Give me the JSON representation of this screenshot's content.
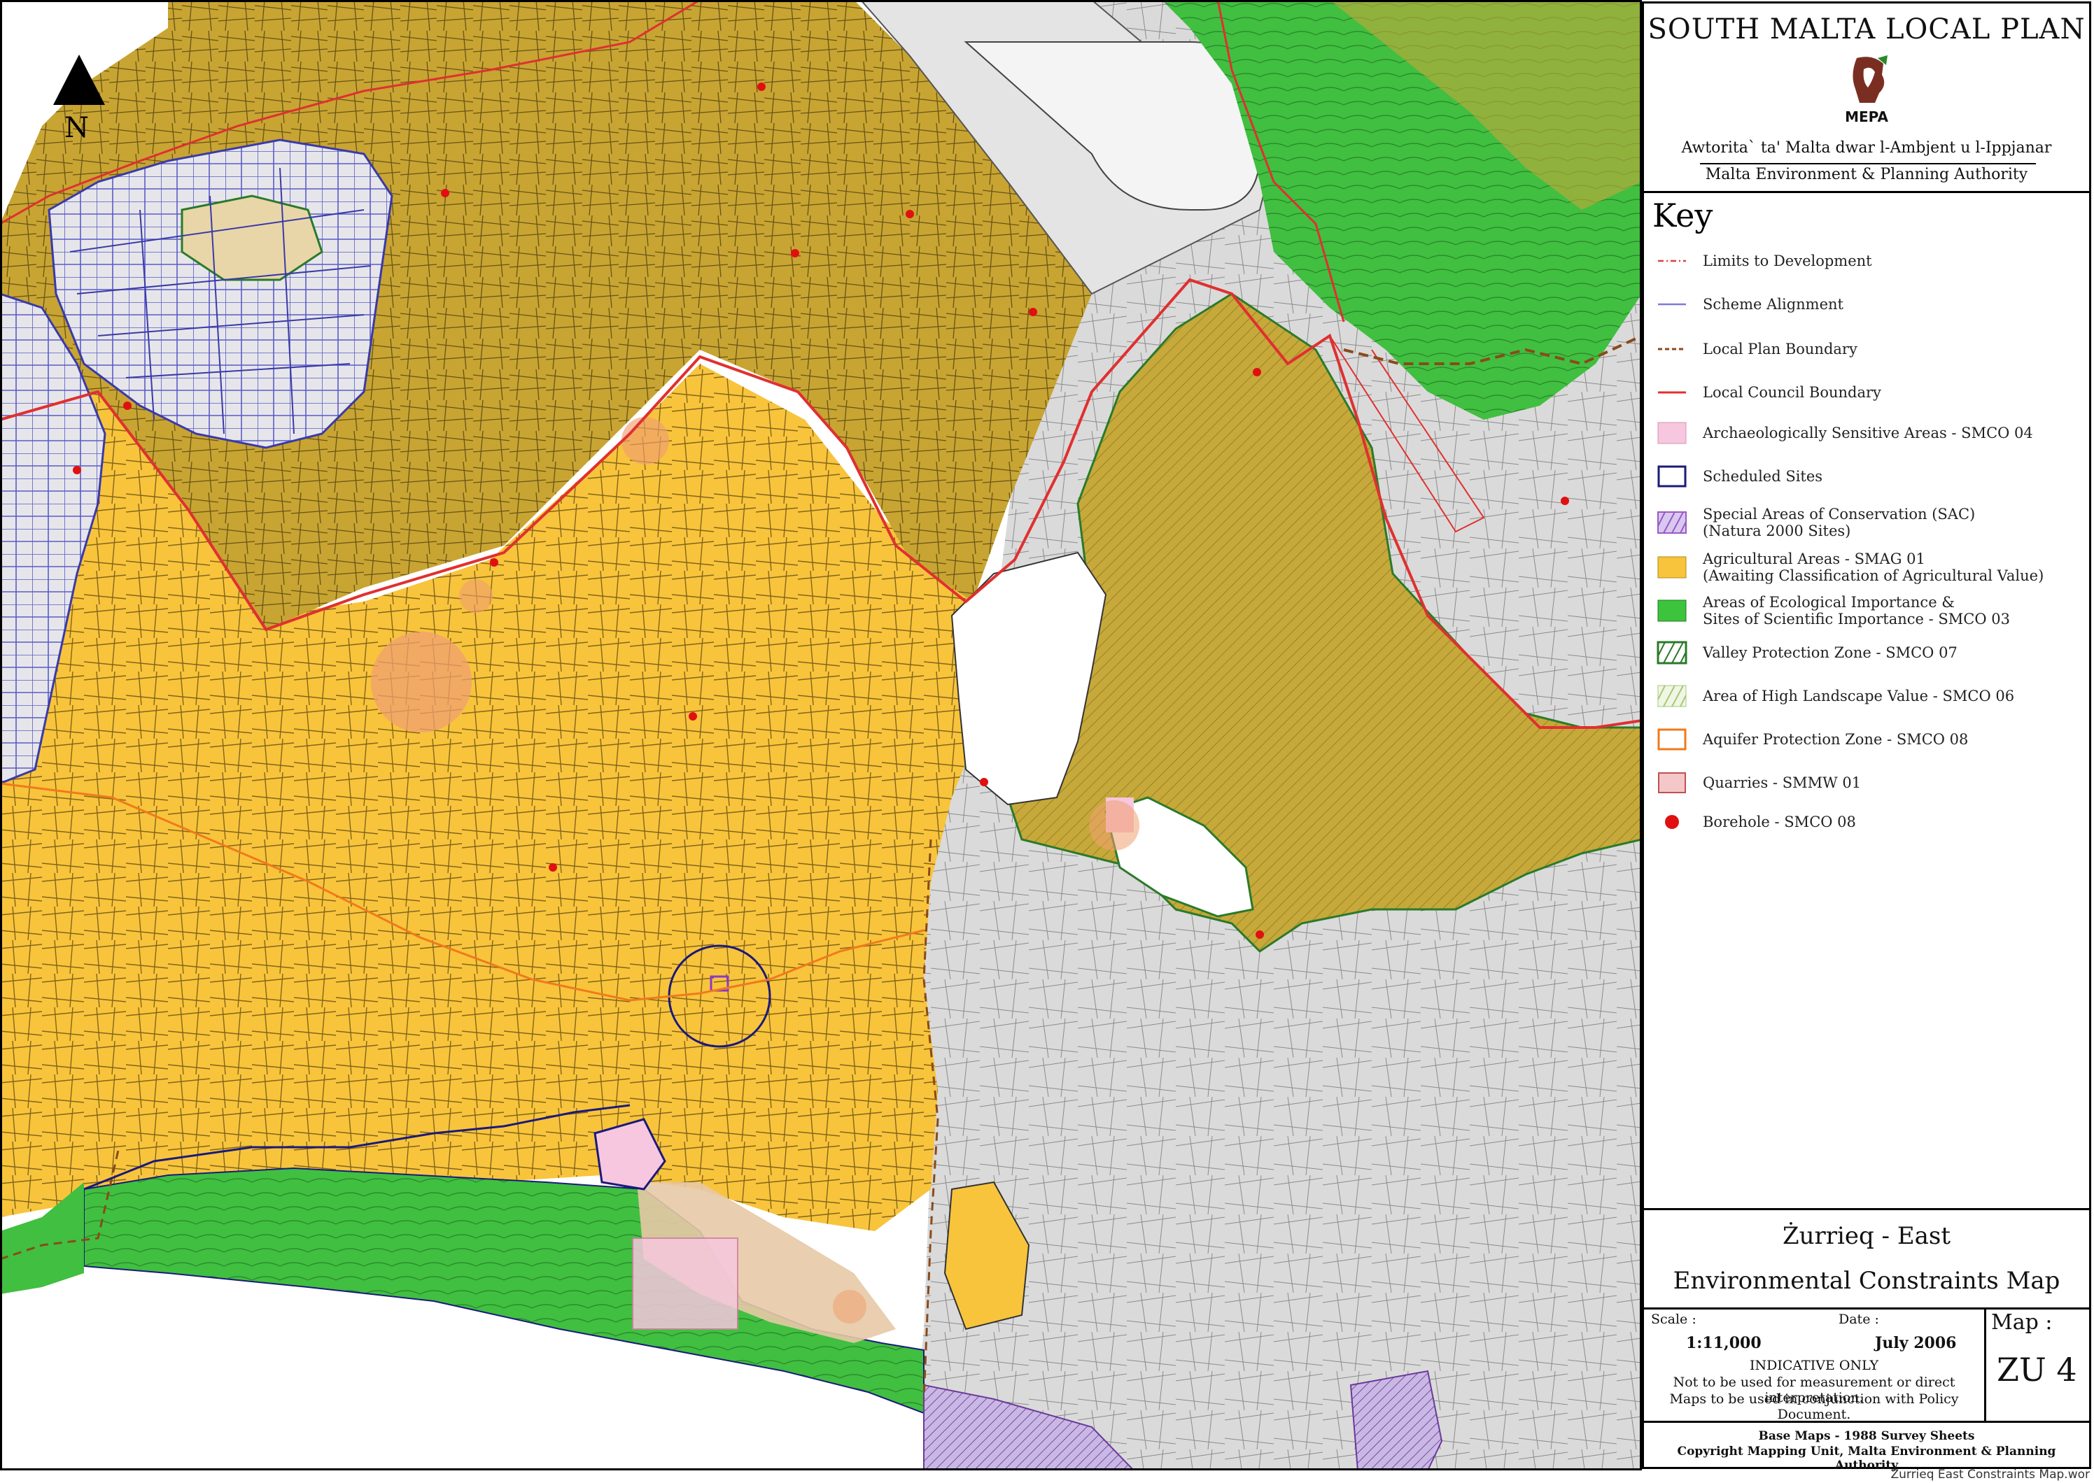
{
  "header": {
    "plan_title": "SOUTH MALTA LOCAL PLAN",
    "logo_text": "MEPA",
    "authority_mt": "Awtorita` ta' Malta dwar l-Ambjent u l-Ippjanar",
    "authority_en": "Malta Environment & Planning Authority"
  },
  "key": {
    "title": "Key",
    "items": [
      {
        "label": "Limits to Development",
        "swatch": "dashdot-line",
        "color": "#d94040"
      },
      {
        "label": "Scheme Alignment",
        "swatch": "line",
        "color": "#7b7bd6"
      },
      {
        "label": "Local Plan Boundary",
        "swatch": "dashed-line",
        "color": "#8a4a1a"
      },
      {
        "label": "Local Council Boundary",
        "swatch": "line",
        "color": "#e03030"
      },
      {
        "label": "Archaeologically Sensitive Areas - SMCO 04",
        "swatch": "fill",
        "color": "#f6c7de"
      },
      {
        "label": "Scheduled Sites",
        "swatch": "outline",
        "color": "#1a1a7a"
      },
      {
        "label": "Special Areas of Conservation (SAC)",
        "label2": "(Natura 2000 Sites)",
        "swatch": "hatch",
        "color": "#9a5ac8"
      },
      {
        "label": "Agricultural Areas - SMAG 01",
        "label2": "(Awaiting Classification of Agricultural Value)",
        "swatch": "fill",
        "color": "#f8c43c"
      },
      {
        "label": "Areas of Ecological Importance &",
        "label2": "Sites of Scientific Importance - SMCO 03",
        "swatch": "fill",
        "color": "#3cc43c"
      },
      {
        "label": "Valley Protection Zone - SMCO 07",
        "swatch": "hatch",
        "color": "#2a7a2a"
      },
      {
        "label": "Area of High Landscape Value - SMCO 06",
        "swatch": "hatch",
        "color": "#a8c878"
      },
      {
        "label": "Aquifer Protection Zone - SMCO 08",
        "swatch": "outline",
        "color": "#f07a1a"
      },
      {
        "label": "Quarries - SMMW 01",
        "swatch": "fill-outline",
        "color": "#f4c8c8"
      },
      {
        "label": "Borehole - SMCO 08",
        "swatch": "dot",
        "color": "#e01010"
      }
    ]
  },
  "location": {
    "name": "Żurrieq - East",
    "subtitle": "Environmental Constraints Map"
  },
  "info": {
    "scale_label": "Scale :",
    "scale_value": "1:11,000",
    "date_label": "Date :",
    "date_value": "July 2006",
    "indicative": "INDICATIVE ONLY",
    "note1": "Not to be used for measurement or direct interpretation.",
    "note2": "Maps to be used in conjunction with Policy Document.",
    "map_label": "Map :",
    "map_id": "ZU 4",
    "base_maps": "Base Maps - 1988 Survey Sheets",
    "copyright": "Copyright Mapping Unit, Malta Environment & Planning Authority"
  },
  "map": {
    "north_label": "N",
    "filename": "Zurrieq East Constraints Map.wor"
  }
}
